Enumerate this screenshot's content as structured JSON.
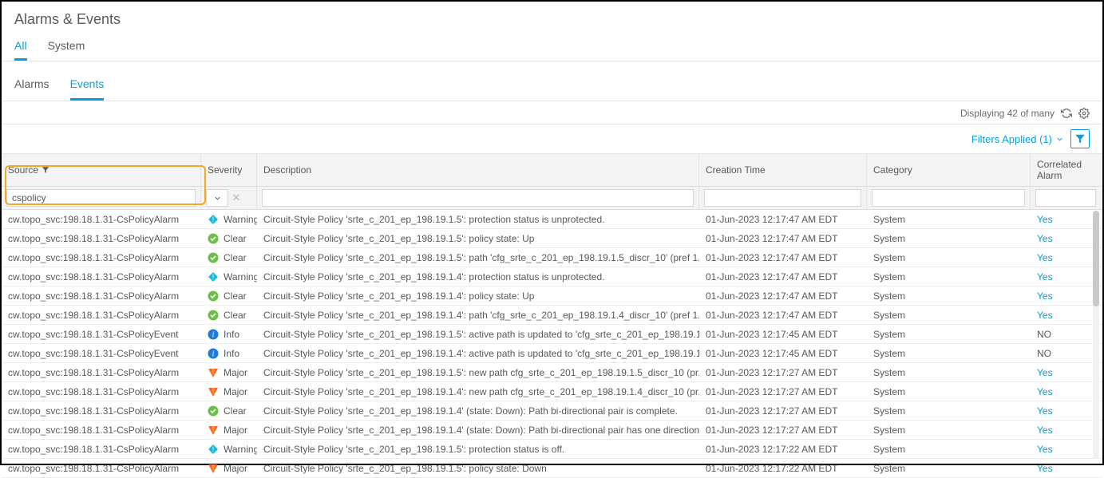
{
  "title": "Alarms & Events",
  "topTabs": {
    "all": "All",
    "system": "System"
  },
  "subTabs": {
    "alarms": "Alarms",
    "events": "Events"
  },
  "status": "Displaying 42 of many",
  "filtersApplied": "Filters Applied (1)",
  "columns": {
    "source": "Source",
    "severity": "Severity",
    "description": "Description",
    "creationTime": "Creation Time",
    "category": "Category",
    "correlated": "Correlated Alarm"
  },
  "filters": {
    "source": "cspolicy",
    "severity": "",
    "description": "",
    "creationTime": "",
    "category": "",
    "correlated": ""
  },
  "severityLabels": {
    "warning": "Warning",
    "clear": "Clear",
    "info": "Info",
    "major": "Major"
  },
  "correlated": {
    "yes": "Yes",
    "no": "NO"
  },
  "rows": [
    {
      "source": "cw.topo_svc:198.18.1.31-CsPolicyAlarm",
      "sev": "warning",
      "desc": "Circuit-Style Policy 'srte_c_201_ep_198.19.1.5': protection status is unprotected.",
      "time": "01-Jun-2023 12:17:47 AM EDT",
      "cat": "System",
      "corr": "yes"
    },
    {
      "source": "cw.topo_svc:198.18.1.31-CsPolicyAlarm",
      "sev": "clear",
      "desc": "Circuit-Style Policy 'srte_c_201_ep_198.19.1.5': policy state: Up",
      "time": "01-Jun-2023 12:17:47 AM EDT",
      "cat": "System",
      "corr": "yes"
    },
    {
      "source": "cw.topo_svc:198.18.1.31-CsPolicyAlarm",
      "sev": "clear",
      "desc": "Circuit-Style Policy 'srte_c_201_ep_198.19.1.5': path 'cfg_srte_c_201_ep_198.19.1.5_discr_10' (pref 1...",
      "time": "01-Jun-2023 12:17:47 AM EDT",
      "cat": "System",
      "corr": "yes"
    },
    {
      "source": "cw.topo_svc:198.18.1.31-CsPolicyAlarm",
      "sev": "warning",
      "desc": "Circuit-Style Policy 'srte_c_201_ep_198.19.1.4': protection status is unprotected.",
      "time": "01-Jun-2023 12:17:47 AM EDT",
      "cat": "System",
      "corr": "yes"
    },
    {
      "source": "cw.topo_svc:198.18.1.31-CsPolicyAlarm",
      "sev": "clear",
      "desc": "Circuit-Style Policy 'srte_c_201_ep_198.19.1.4': policy state: Up",
      "time": "01-Jun-2023 12:17:47 AM EDT",
      "cat": "System",
      "corr": "yes"
    },
    {
      "source": "cw.topo_svc:198.18.1.31-CsPolicyAlarm",
      "sev": "clear",
      "desc": "Circuit-Style Policy 'srte_c_201_ep_198.19.1.4': path 'cfg_srte_c_201_ep_198.19.1.4_discr_10' (pref 1...",
      "time": "01-Jun-2023 12:17:47 AM EDT",
      "cat": "System",
      "corr": "yes"
    },
    {
      "source": "cw.topo_svc:198.18.1.31-CsPolicyEvent",
      "sev": "info",
      "desc": "Circuit-Style Policy 'srte_c_201_ep_198.19.1.5': active path is updated to 'cfg_srte_c_201_ep_198.19.1...",
      "time": "01-Jun-2023 12:17:45 AM EDT",
      "cat": "System",
      "corr": "no"
    },
    {
      "source": "cw.topo_svc:198.18.1.31-CsPolicyEvent",
      "sev": "info",
      "desc": "Circuit-Style Policy 'srte_c_201_ep_198.19.1.4': active path is updated to 'cfg_srte_c_201_ep_198.19.1...",
      "time": "01-Jun-2023 12:17:45 AM EDT",
      "cat": "System",
      "corr": "no"
    },
    {
      "source": "cw.topo_svc:198.18.1.31-CsPolicyAlarm",
      "sev": "major",
      "desc": "Circuit-Style Policy 'srte_c_201_ep_198.19.1.5': new path cfg_srte_c_201_ep_198.19.1.5_discr_10 (pr...",
      "time": "01-Jun-2023 12:17:27 AM EDT",
      "cat": "System",
      "corr": "yes"
    },
    {
      "source": "cw.topo_svc:198.18.1.31-CsPolicyAlarm",
      "sev": "major",
      "desc": "Circuit-Style Policy 'srte_c_201_ep_198.19.1.4': new path cfg_srte_c_201_ep_198.19.1.4_discr_10 (pr...",
      "time": "01-Jun-2023 12:17:27 AM EDT",
      "cat": "System",
      "corr": "yes"
    },
    {
      "source": "cw.topo_svc:198.18.1.31-CsPolicyAlarm",
      "sev": "clear",
      "desc": "Circuit-Style Policy 'srte_c_201_ep_198.19.1.4' (state: Down): Path bi-directional pair is complete.",
      "time": "01-Jun-2023 12:17:27 AM EDT",
      "cat": "System",
      "corr": "yes"
    },
    {
      "source": "cw.topo_svc:198.18.1.31-CsPolicyAlarm",
      "sev": "major",
      "desc": "Circuit-Style Policy 'srte_c_201_ep_198.19.1.4' (state: Down): Path bi-directional pair has one direction mi...",
      "time": "01-Jun-2023 12:17:27 AM EDT",
      "cat": "System",
      "corr": "yes"
    },
    {
      "source": "cw.topo_svc:198.18.1.31-CsPolicyAlarm",
      "sev": "warning",
      "desc": "Circuit-Style Policy 'srte_c_201_ep_198.19.1.5': protection status is off.",
      "time": "01-Jun-2023 12:17:22 AM EDT",
      "cat": "System",
      "corr": "yes"
    },
    {
      "source": "cw.topo_svc:198.18.1.31-CsPolicyAlarm",
      "sev": "major",
      "desc": "Circuit-Style Policy 'srte_c_201_ep_198.19.1.5': policy state: Down",
      "time": "01-Jun-2023 12:17:22 AM EDT",
      "cat": "System",
      "corr": "yes"
    }
  ]
}
